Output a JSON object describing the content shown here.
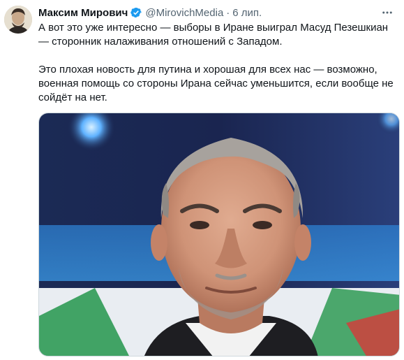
{
  "author": {
    "name": "Максим Мирович",
    "handle": "@MirovichMedia",
    "separator": "·",
    "time": "6 лип."
  },
  "tweet": {
    "paragraph1": "А вот это уже интересно — выборы в Иране выиграл Масуд Пезешкиан — сторонник налаживания отношений с Западом.",
    "paragraph2": "Это плохая новость для путина и хорошая для всех нас — возможно, военная помощь со стороны Ирана сейчас уменьшится, если вообще не сойдёт на нет."
  },
  "icons": {
    "verified": "verified-badge-icon",
    "more": "more-options-icon"
  },
  "colors": {
    "verified_blue": "#1d9bf0",
    "secondary_text": "#536471",
    "primary_text": "#0f1419"
  }
}
